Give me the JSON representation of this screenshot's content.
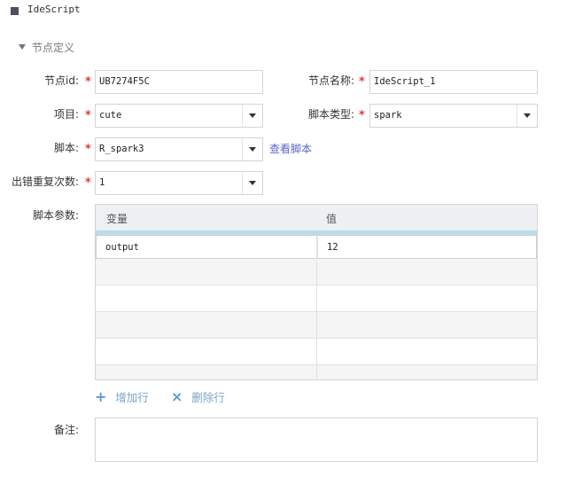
{
  "panel": {
    "title": "IdeScript"
  },
  "section": {
    "label": "节点定义"
  },
  "form": {
    "node_id": {
      "label": "节点id:",
      "value": "UB7274F5C"
    },
    "node_name": {
      "label": "节点名称:",
      "value": "IdeScript_1"
    },
    "project": {
      "label": "项目:",
      "value": "cute"
    },
    "script_type": {
      "label": "脚本类型:",
      "value": "spark"
    },
    "script": {
      "label": "脚本:",
      "value": "R_spark3",
      "link": "查看脚本"
    },
    "retry": {
      "label": "出错重复次数:",
      "value": "1"
    },
    "required_mark": "*"
  },
  "params": {
    "label": "脚本参数:",
    "columns": [
      "变量",
      "值"
    ],
    "rows": [
      {
        "variable": "output",
        "value": "12"
      },
      {
        "variable": "",
        "value": ""
      },
      {
        "variable": "",
        "value": ""
      },
      {
        "variable": "",
        "value": ""
      },
      {
        "variable": "",
        "value": ""
      },
      {
        "variable": "",
        "value": ""
      }
    ],
    "add_row": "增加行",
    "delete_row": "删除行"
  },
  "remark": {
    "label": "备注:",
    "value": ""
  }
}
